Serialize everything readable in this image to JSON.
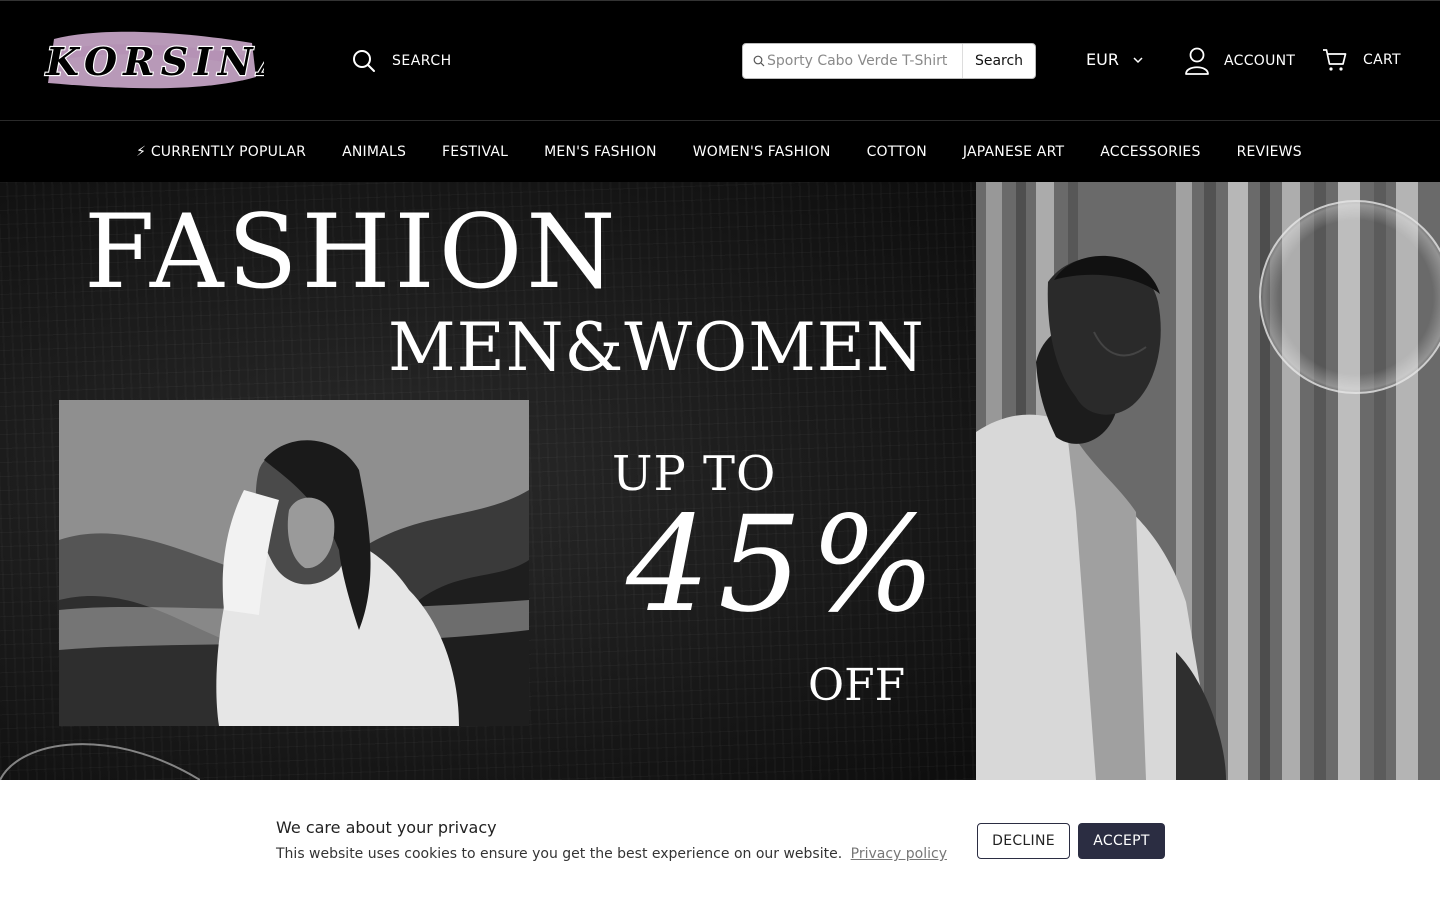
{
  "brand": {
    "logo_text": "KORSINA"
  },
  "header": {
    "search_label": "SEARCH",
    "search_placeholder": "Sporty Cabo Verde T-Shirt",
    "search_button": "Search",
    "currency": "EUR",
    "account_label": "ACCOUNT",
    "cart_label": "CART"
  },
  "nav": {
    "items": [
      {
        "label": "⚡ CURRENTLY POPULAR"
      },
      {
        "label": "ANIMALS"
      },
      {
        "label": "FESTIVAL"
      },
      {
        "label": "MEN'S FASHION"
      },
      {
        "label": "WOMEN'S FASHION"
      },
      {
        "label": "COTTON"
      },
      {
        "label": "JAPANESE ART"
      },
      {
        "label": "ACCESSORIES"
      },
      {
        "label": "REVIEWS"
      }
    ]
  },
  "hero": {
    "title": "FASHION",
    "subtitle": "MEN&WOMEN",
    "up_to": "UP TO",
    "percent": "45%",
    "off": "OFF"
  },
  "cookie": {
    "title": "We care about your privacy",
    "message": "This website uses cookies to ensure you get the best experience on our website.",
    "policy_link": "Privacy policy",
    "decline": "DECLINE",
    "accept": "ACCEPT"
  },
  "colors": {
    "header_bg": "#000000",
    "cookie_accept_bg": "#2b2d42",
    "logo_brush": "#d8b4d8"
  },
  "icons": {
    "search": "search-icon",
    "account": "user-icon",
    "cart": "cart-icon",
    "currency": "chevron-down-icon"
  }
}
